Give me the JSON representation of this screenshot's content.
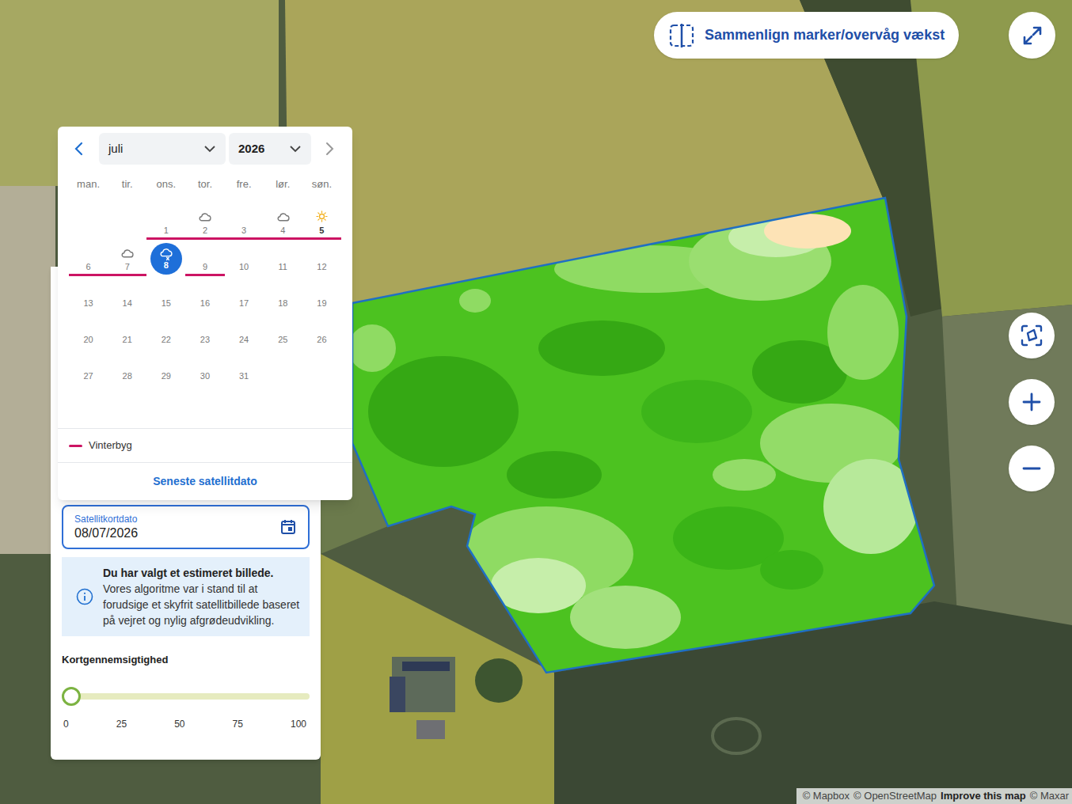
{
  "compare_button": {
    "label": "Sammenlign marker/overvåg vækst"
  },
  "calendar": {
    "month": "juli",
    "year": "2026",
    "weekdays": [
      "man.",
      "tir.",
      "ons.",
      "tor.",
      "fre.",
      "lør.",
      "søn."
    ],
    "days": [
      {
        "day": "1",
        "weather": "none",
        "crop": true,
        "selected": false,
        "available": false
      },
      {
        "day": "2",
        "weather": "cloud",
        "crop": true,
        "selected": false,
        "available": false
      },
      {
        "day": "3",
        "weather": "none",
        "crop": true,
        "selected": false,
        "available": false
      },
      {
        "day": "4",
        "weather": "cloud",
        "crop": true,
        "selected": false,
        "available": false
      },
      {
        "day": "5",
        "weather": "sun",
        "crop": true,
        "selected": false,
        "available": true
      },
      {
        "day": "6",
        "weather": "none",
        "crop": true,
        "selected": false,
        "available": false
      },
      {
        "day": "7",
        "weather": "cloud",
        "crop": true,
        "selected": false,
        "available": false
      },
      {
        "day": "8",
        "weather": "cloud-rain",
        "crop": false,
        "selected": true,
        "available": false
      },
      {
        "day": "9",
        "weather": "none",
        "crop": true,
        "selected": false,
        "available": false
      },
      {
        "day": "10",
        "weather": "none",
        "crop": false,
        "selected": false,
        "available": false
      },
      {
        "day": "11",
        "weather": "none",
        "crop": false,
        "selected": false,
        "available": false
      },
      {
        "day": "12",
        "weather": "none",
        "crop": false,
        "selected": false,
        "available": false
      },
      {
        "day": "13",
        "weather": "none",
        "crop": false,
        "selected": false,
        "available": false
      },
      {
        "day": "14",
        "weather": "none",
        "crop": false,
        "selected": false,
        "available": false
      },
      {
        "day": "15",
        "weather": "none",
        "crop": false,
        "selected": false,
        "available": false
      },
      {
        "day": "16",
        "weather": "none",
        "crop": false,
        "selected": false,
        "available": false
      },
      {
        "day": "17",
        "weather": "none",
        "crop": false,
        "selected": false,
        "available": false
      },
      {
        "day": "18",
        "weather": "none",
        "crop": false,
        "selected": false,
        "available": false
      },
      {
        "day": "19",
        "weather": "none",
        "crop": false,
        "selected": false,
        "available": false
      },
      {
        "day": "20",
        "weather": "none",
        "crop": false,
        "selected": false,
        "available": false
      },
      {
        "day": "21",
        "weather": "none",
        "crop": false,
        "selected": false,
        "available": false
      },
      {
        "day": "22",
        "weather": "none",
        "crop": false,
        "selected": false,
        "available": false
      },
      {
        "day": "23",
        "weather": "none",
        "crop": false,
        "selected": false,
        "available": false
      },
      {
        "day": "24",
        "weather": "none",
        "crop": false,
        "selected": false,
        "available": false
      },
      {
        "day": "25",
        "weather": "none",
        "crop": false,
        "selected": false,
        "available": false
      },
      {
        "day": "26",
        "weather": "none",
        "crop": false,
        "selected": false,
        "available": false
      },
      {
        "day": "27",
        "weather": "none",
        "crop": false,
        "selected": false,
        "available": false
      },
      {
        "day": "28",
        "weather": "none",
        "crop": false,
        "selected": false,
        "available": false
      },
      {
        "day": "29",
        "weather": "none",
        "crop": false,
        "selected": false,
        "available": false
      },
      {
        "day": "30",
        "weather": "none",
        "crop": false,
        "selected": false,
        "available": false
      },
      {
        "day": "31",
        "weather": "none",
        "crop": false,
        "selected": false,
        "available": false
      }
    ],
    "legend": [
      {
        "label": "Vinterbyg",
        "color": "#cc1463"
      }
    ],
    "latest_button": "Seneste satellitdato"
  },
  "date_field": {
    "label": "Satellitkortdato",
    "value": "08/07/2026"
  },
  "notice": {
    "title": "Du har valgt et estimeret billede.",
    "body": "Vores algoritme var i stand til at forudsige et skyfrit satellitbillede baseret på vejret og nylig afgrødeudvikling."
  },
  "opacity": {
    "label": "Kortgennemsigtighed",
    "level": 0,
    "ticks": [
      "0",
      "25",
      "50",
      "75",
      "100"
    ]
  },
  "attribution": [
    {
      "text": "© Mapbox",
      "bold": false
    },
    {
      "text": "© OpenStreetMap",
      "bold": false
    },
    {
      "text": "Improve this map",
      "bold": true
    },
    {
      "text": "© Maxar",
      "bold": false
    }
  ]
}
